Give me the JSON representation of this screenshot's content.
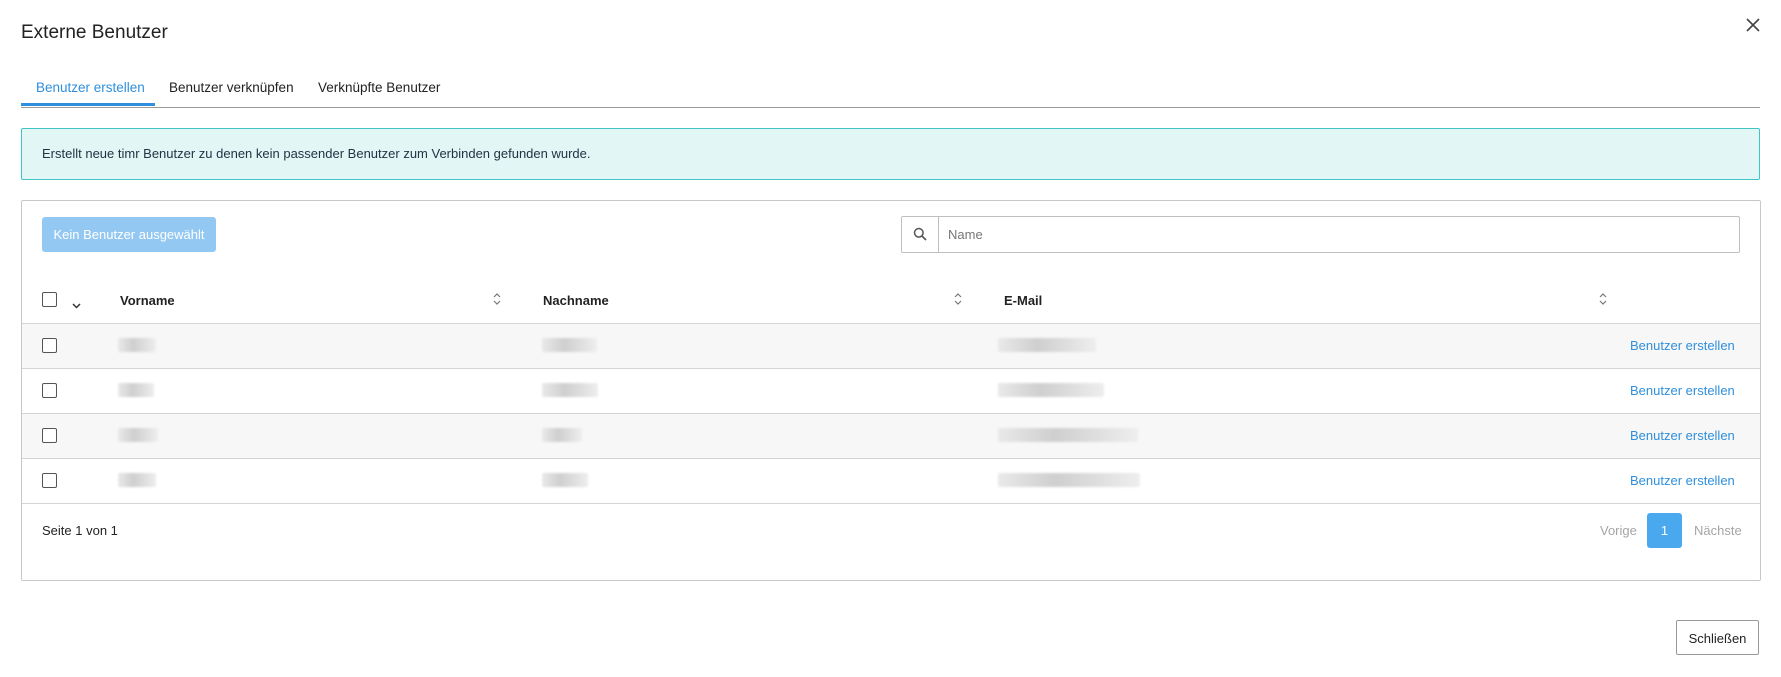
{
  "dialog": {
    "title": "Externe Benutzer",
    "close_icon": "close-icon"
  },
  "tabs": [
    {
      "label": "Benutzer erstellen",
      "active": true
    },
    {
      "label": "Benutzer verknüpfen",
      "active": false
    },
    {
      "label": "Verknüpfte Benutzer",
      "active": false
    }
  ],
  "info_message": "Erstellt neue timr Benutzer zu denen kein passender Benutzer zum Verbinden gefunden wurde.",
  "toolbar": {
    "action_button_label": "Kein Benutzer ausgewählt",
    "search_icon": "search-icon",
    "search_placeholder": "Name",
    "search_value": ""
  },
  "table": {
    "columns": [
      {
        "label": "Vorname"
      },
      {
        "label": "Nachname"
      },
      {
        "label": "E-Mail"
      }
    ],
    "rows": [
      {
        "action_label": "Benutzer erstellen"
      },
      {
        "action_label": "Benutzer erstellen"
      },
      {
        "action_label": "Benutzer erstellen"
      },
      {
        "action_label": "Benutzer erstellen"
      }
    ]
  },
  "pagination": {
    "summary": "Seite 1 von 1",
    "prev_label": "Vorige",
    "current_page": "1",
    "next_label": "Nächste"
  },
  "footer": {
    "close_label": "Schließen"
  },
  "colors": {
    "accent": "#2f8fdc",
    "info_bg": "#e3f6f6",
    "info_border": "#3fc5c6",
    "disabled_button": "#93c8f3"
  }
}
